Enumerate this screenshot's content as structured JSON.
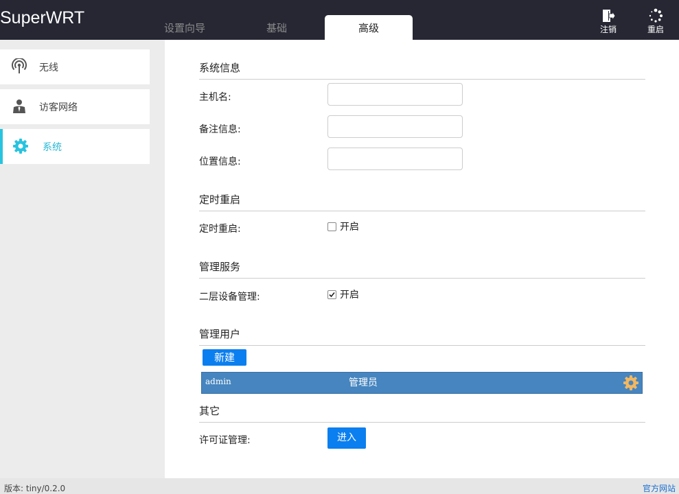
{
  "app": {
    "brand": "SuperWRT"
  },
  "tabs": [
    {
      "label": "设置向导"
    },
    {
      "label": "基础"
    },
    {
      "label": "高级"
    }
  ],
  "header_actions": {
    "logout": "注销",
    "reboot": "重启"
  },
  "sidebar": {
    "items": [
      {
        "label": "无线",
        "icon": "wifi-icon"
      },
      {
        "label": "访客网络",
        "icon": "guest-user-icon"
      },
      {
        "label": "系统",
        "icon": "gear-icon",
        "active": true
      }
    ]
  },
  "system_info": {
    "title": "系统信息",
    "hostname_label": "主机名:",
    "hostname_value": "",
    "note_label": "备注信息:",
    "note_value": "",
    "location_label": "位置信息:",
    "location_value": ""
  },
  "scheduled_reboot": {
    "title": "定时重启",
    "label": "定时重启:",
    "checkbox_label": "开启",
    "checked": false
  },
  "management_service": {
    "title": "管理服务",
    "label": "二层设备管理:",
    "checkbox_label": "开启",
    "checked": true
  },
  "admin_users": {
    "title": "管理用户",
    "new_button": "新建",
    "users": [
      {
        "name": "admin",
        "role": "管理员"
      }
    ]
  },
  "other": {
    "title": "其它",
    "license_label": "许可证管理:",
    "enter_button": "进入"
  },
  "footer": {
    "version": "版本: tiny/0.2.0",
    "official_site": "官方网站"
  },
  "colors": {
    "topbar": "#262733",
    "accent": "#29c3df",
    "button": "#0b7ff0",
    "user_row": "#4685bf",
    "gear": "#f3b760"
  }
}
